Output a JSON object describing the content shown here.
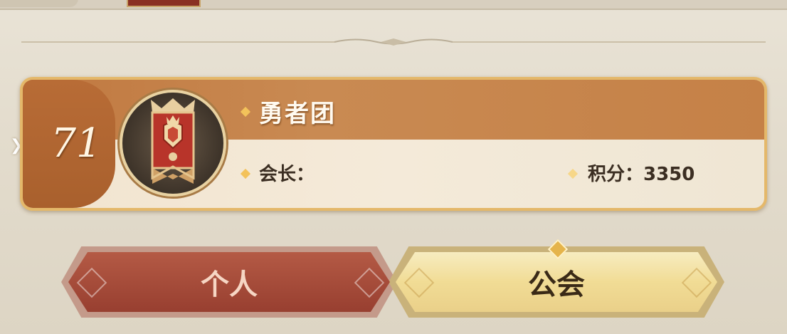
{
  "guild": {
    "rank": "71",
    "name": "勇者团",
    "leader_label": "会长：",
    "score_label": "积分：3350"
  },
  "tabs": {
    "personal_label": "个人",
    "guild_label": "公会",
    "selected": "公会"
  },
  "colors": {
    "card_border": "#e4b86a",
    "banner_band": "#c07840",
    "personal_tab": "#983f30",
    "guild_tab": "#f1dc95"
  },
  "icons": {
    "emblem": "guild-banner-crest-icon",
    "bullet": "gold-diamond-icon"
  }
}
